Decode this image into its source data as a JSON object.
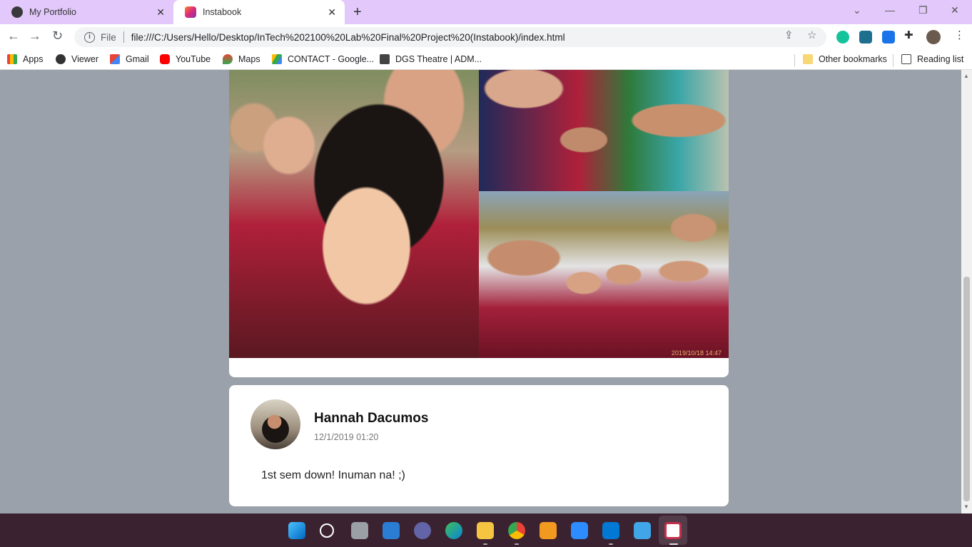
{
  "browser": {
    "tabs": [
      {
        "title": "My Portfolio",
        "icon": "globe-icon",
        "active": false
      },
      {
        "title": "Instabook",
        "icon": "instabook-icon",
        "active": true
      }
    ],
    "address": {
      "scheme_label": "File",
      "url": "file:///C:/Users/Hello/Desktop/InTech%202100%20Lab%20Final%20Project%20(Instabook)/index.html"
    },
    "bookmarks": [
      {
        "label": "Apps",
        "icon": "apps-grid-icon"
      },
      {
        "label": "Viewer",
        "icon": "globe-icon"
      },
      {
        "label": "Gmail",
        "icon": "gmail-icon"
      },
      {
        "label": "YouTube",
        "icon": "youtube-icon"
      },
      {
        "label": "Maps",
        "icon": "maps-pin-icon"
      },
      {
        "label": "CONTACT - Google...",
        "icon": "google-drive-icon"
      },
      {
        "label": "DGS Theatre | ADM...",
        "icon": "theatre-icon"
      }
    ],
    "other_bookmarks": "Other bookmarks",
    "reading_list": "Reading list"
  },
  "feed": {
    "post1": {
      "photo_stamp": "2019/10/18 14:47"
    },
    "post2": {
      "author": "Hannah Dacumos",
      "timestamp": "12/1/2019 01:20",
      "text": "1st sem down! Inuman na! ;)"
    }
  },
  "colors": {
    "tabstrip": "#e3c9fb",
    "page_background": "#9aa1aa",
    "taskbar": "#3b2230"
  }
}
